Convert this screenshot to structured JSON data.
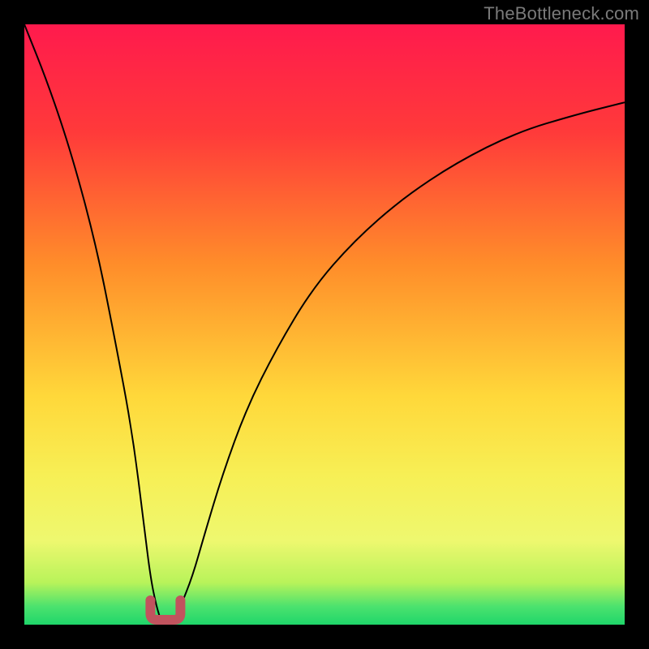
{
  "attribution": "TheBottleneck.com",
  "colors": {
    "frame": "#000000",
    "curve": "#000000",
    "bottom_mark": "#c1535e"
  },
  "chart_data": {
    "type": "line",
    "title": "",
    "xlabel": "",
    "ylabel": "",
    "xlim": [
      0,
      100
    ],
    "ylim": [
      0,
      100
    ],
    "grid": false,
    "legend": false,
    "gradient_stops": [
      {
        "pct": 0,
        "color": "#ff1a4d"
      },
      {
        "pct": 18,
        "color": "#ff3a3a"
      },
      {
        "pct": 40,
        "color": "#ff8d2a"
      },
      {
        "pct": 62,
        "color": "#ffd83a"
      },
      {
        "pct": 75,
        "color": "#f7ef55"
      },
      {
        "pct": 86,
        "color": "#eef86f"
      },
      {
        "pct": 93,
        "color": "#b8f35a"
      },
      {
        "pct": 97,
        "color": "#4be26e"
      },
      {
        "pct": 100,
        "color": "#1fd66a"
      }
    ],
    "series": [
      {
        "name": "bottleneck-curve",
        "x": [
          0,
          4,
          8,
          12,
          15,
          18,
          20,
          21,
          22,
          23,
          24,
          25,
          26,
          28,
          30,
          33,
          37,
          42,
          48,
          55,
          63,
          72,
          82,
          92,
          100
        ],
        "y": [
          100,
          90,
          78,
          63,
          48,
          32,
          16,
          8,
          3,
          0,
          0,
          0,
          3,
          8,
          15,
          25,
          36,
          46,
          56,
          64,
          71,
          77,
          82,
          85,
          87
        ]
      }
    ],
    "annotation": {
      "name": "minimum-marker",
      "x_range": [
        21,
        26
      ],
      "y": 0
    }
  }
}
